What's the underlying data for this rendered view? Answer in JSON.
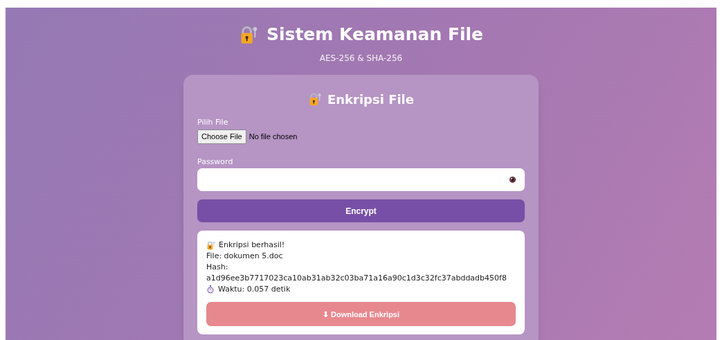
{
  "header": {
    "title": "Sistem Keamanan File",
    "subtitle": "AES-256 & SHA-256"
  },
  "card": {
    "title": "Enkripsi File",
    "file_field": {
      "label": "Pilih File",
      "button": "Choose File",
      "status": "No file chosen"
    },
    "password_field": {
      "label": "Password"
    },
    "submit": "Encrypt",
    "result": {
      "message": "Enkripsi berhasil!",
      "file": "File: dokumen 5.doc",
      "hash": "Hash: a1d96ee3b7717023ca10ab31ab32c03ba71a16a90c1d3c32fc37abddadb450f8",
      "time": "Waktu: 0.057 detik",
      "download": "⬇ Download Enkripsi"
    }
  }
}
